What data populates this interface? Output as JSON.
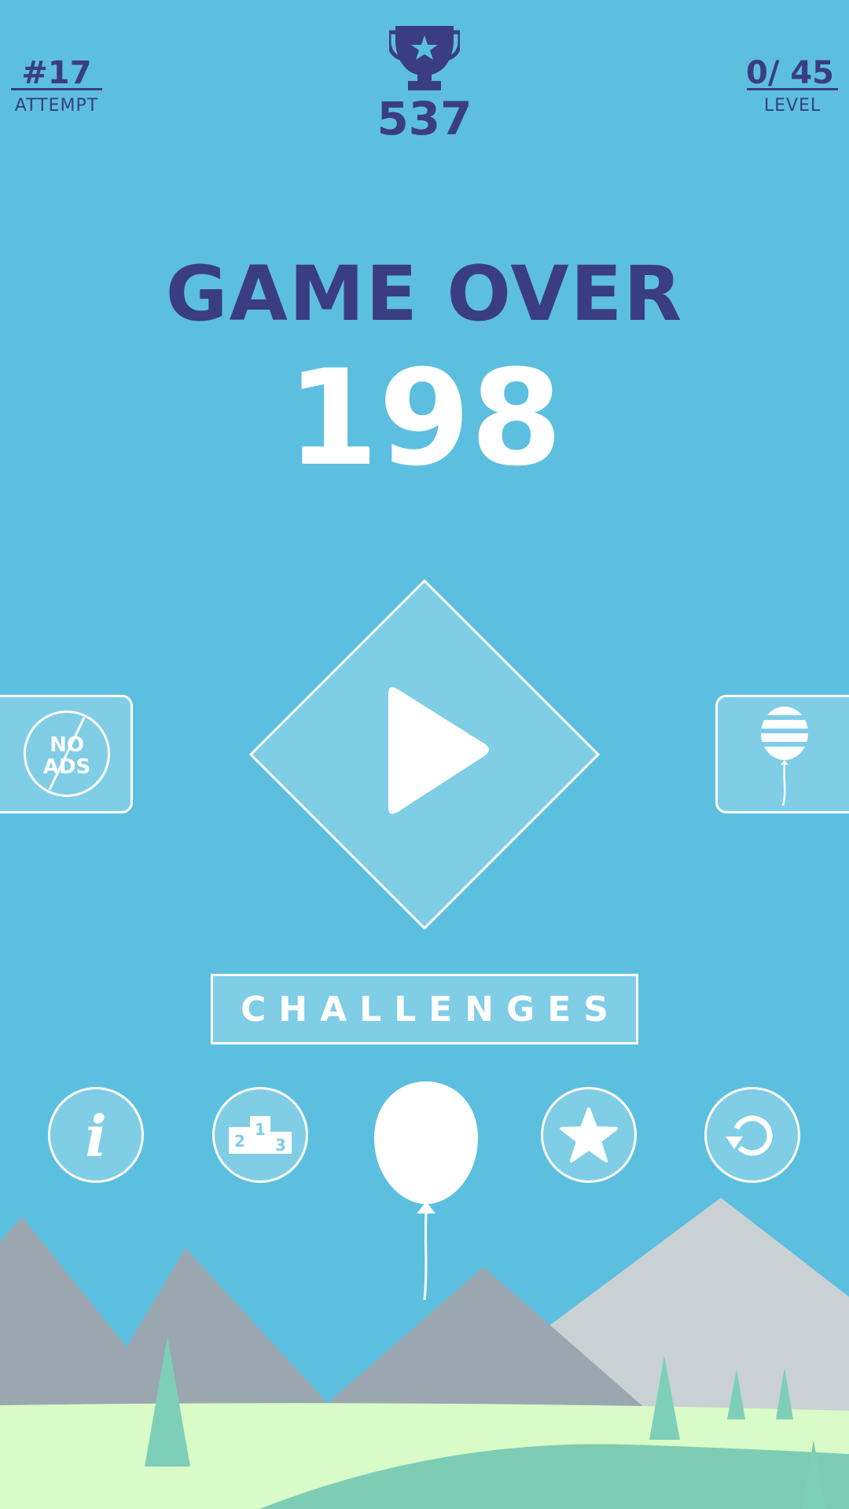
{
  "colors": {
    "sky": "#5dbfdf",
    "navy": "#3a3d82",
    "white": "#ffffff",
    "panel_fill": "#80cde6",
    "mountain_dark": "#9aa7b0",
    "mountain_light": "#c9d1d4",
    "grass_light": "#d9fbc7",
    "grass_dark": "#7dcdb5",
    "tree": "#7ecfb8"
  },
  "hud": {
    "attempt_value": "#17",
    "attempt_label": "ATTEMPT",
    "best_score": "537",
    "best_icon": "trophy-icon",
    "level_value": "0/ 45",
    "level_label": "LEVEL"
  },
  "game_over": {
    "title": "GAME OVER",
    "score": "198"
  },
  "play_button": {
    "icon": "play-icon"
  },
  "no_ads_button": {
    "line1": "NO",
    "line2": "ADS"
  },
  "balloon_shop_button": {
    "icon": "striped-balloon-icon"
  },
  "challenges_button": {
    "label": "CHALLENGES"
  },
  "bottom_bar": {
    "info_glyph": "i",
    "leaderboard": {
      "icon": "podium-icon",
      "first": "1",
      "second": "2",
      "third": "3"
    },
    "player_icon": "balloon-icon",
    "rate_icon": "star-icon",
    "restart_icon": "restart-icon"
  }
}
